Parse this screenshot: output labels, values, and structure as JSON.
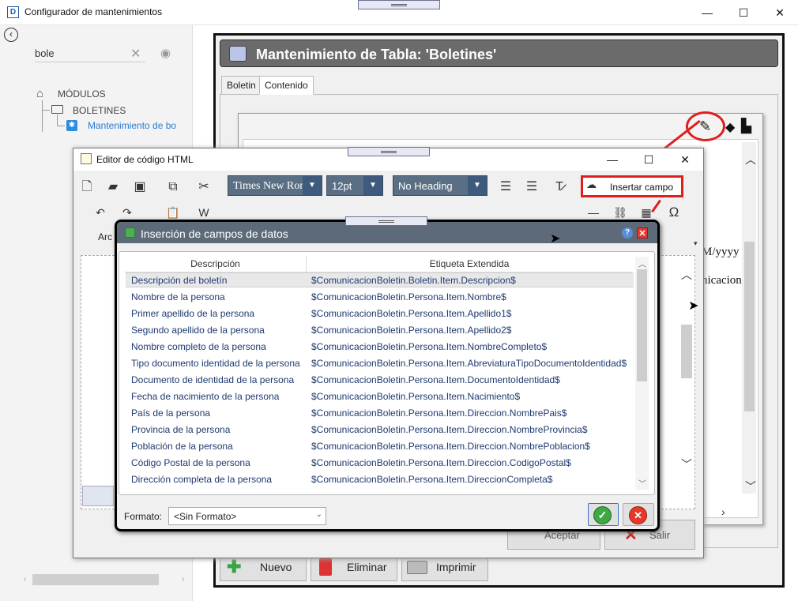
{
  "window": {
    "title": "Configurador de mantenimientos",
    "icon_letter": "D"
  },
  "left_pane": {
    "search_value": "bole",
    "tree": {
      "root": "MÓDULOS",
      "folder": "BOLETINES",
      "item": "Mantenimiento de bo"
    }
  },
  "maintenance": {
    "title": "Mantenimiento de Tabla: 'Boletines'",
    "tabs": [
      "Boletin",
      "Contenido"
    ],
    "side_text_1": "M/yyyy",
    "side_text_2": "nicacion",
    "buttons": {
      "nuevo": "Nuevo",
      "eliminar": "Eliminar",
      "imprimir": "Imprimir"
    }
  },
  "html_editor": {
    "title": "Editor de código HTML",
    "font": "Times New Roman",
    "size": "12pt",
    "heading": "No Heading",
    "insert_field": "Insertar campo",
    "arc_label": "Arc",
    "buttons": {
      "aceptar": "Aceptar",
      "salir": "Salir"
    }
  },
  "dialog": {
    "title": "Inserción de campos de datos",
    "columns": [
      "Descripción",
      "Etiqueta Extendida"
    ],
    "rows": [
      {
        "desc": "Descripción del boletín",
        "tag": "$ComunicacionBoletin.Boletin.Item.Descripcion$"
      },
      {
        "desc": "Nombre de la persona",
        "tag": "$ComunicacionBoletin.Persona.Item.Nombre$"
      },
      {
        "desc": "Primer apellido de la persona",
        "tag": "$ComunicacionBoletin.Persona.Item.Apellido1$"
      },
      {
        "desc": "Segundo apellido de la persona",
        "tag": "$ComunicacionBoletin.Persona.Item.Apellido2$"
      },
      {
        "desc": "Nombre completo de la persona",
        "tag": "$ComunicacionBoletin.Persona.Item.NombreCompleto$"
      },
      {
        "desc": "Tipo documento identidad de la persona",
        "tag": "$ComunicacionBoletin.Persona.Item.AbreviaturaTipoDocumentoIdentidad$"
      },
      {
        "desc": "Documento de identidad de la persona",
        "tag": "$ComunicacionBoletin.Persona.Item.DocumentoIdentidad$"
      },
      {
        "desc": "Fecha de nacimiento de la persona",
        "tag": "$ComunicacionBoletin.Persona.Item.Nacimiento$"
      },
      {
        "desc": "País de la persona",
        "tag": "$ComunicacionBoletin.Persona.Item.Direccion.NombrePais$"
      },
      {
        "desc": "Provincia de la persona",
        "tag": "$ComunicacionBoletin.Persona.Item.Direccion.NombreProvincia$"
      },
      {
        "desc": "Población de la persona",
        "tag": "$ComunicacionBoletin.Persona.Item.Direccion.NombrePoblacion$"
      },
      {
        "desc": "Código Postal de la persona",
        "tag": "$ComunicacionBoletin.Persona.Item.Direccion.CodigoPostal$"
      },
      {
        "desc": "Dirección completa de la persona",
        "tag": "$ComunicacionBoletin.Persona.Item.DireccionCompleta$"
      }
    ],
    "format_label": "Formato:",
    "format_value": "<Sin Formato>"
  },
  "colors": {
    "accent_red": "#e01e1e",
    "header_gray": "#6b6b6b",
    "combo_blue": "#5a6f84"
  }
}
